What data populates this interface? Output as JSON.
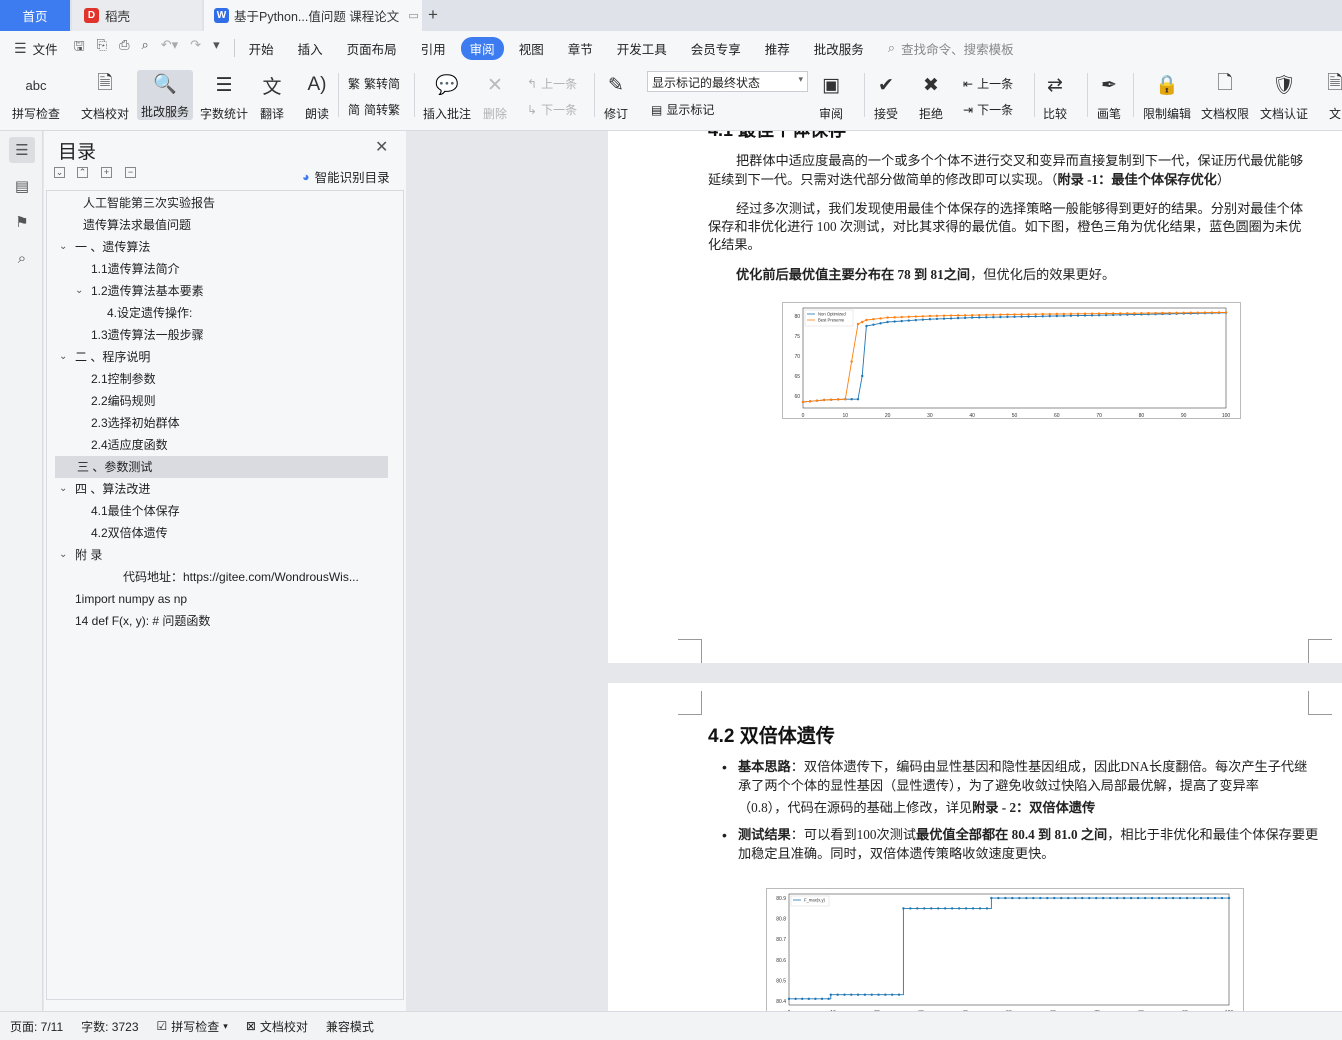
{
  "tabs": {
    "home": "首页",
    "docer": "稻壳",
    "doc": "基于Python...值问题 课程论文"
  },
  "menu": {
    "file": "文件",
    "items": [
      "开始",
      "插入",
      "页面布局",
      "引用",
      "审阅",
      "视图",
      "章节",
      "开发工具",
      "会员专享",
      "推荐",
      "批改服务"
    ],
    "active": "审阅",
    "search": "查找命令、搜索模板"
  },
  "ribbon": {
    "spell": "拼写检查",
    "proof": "文档校对",
    "review_service": "批改服务",
    "wordcount": "字数统计",
    "translate": "翻译",
    "read": "朗读",
    "trad": "繁转简",
    "simp": "简转繁",
    "insert_comment": "插入批注",
    "delete": "删除",
    "prev_comment": "上一条",
    "next_comment": "下一条",
    "revise": "修订",
    "mark_state": "显示标记的最终状态",
    "show_marks": "显示标记",
    "review": "审阅",
    "accept": "接受",
    "reject": "拒绝",
    "prev_change": "上一条",
    "next_change": "下一条",
    "compare": "比较",
    "pen": "画笔",
    "restrict": "限制编辑",
    "doc_rights": "文档权限",
    "doc_cert": "文档认证",
    "doc_more": "文"
  },
  "toc": {
    "title": "目录",
    "smart": "智能识别目录",
    "items": [
      {
        "text": "人工智能第三次实验报告",
        "indent": 1,
        "chev": ""
      },
      {
        "text": "遗传算法求最值问题",
        "indent": 1,
        "chev": ""
      },
      {
        "text": "一 、遗传算法",
        "indent": 0,
        "chev": "v"
      },
      {
        "text": "1.1遗传算法简介",
        "indent": 2,
        "chev": ""
      },
      {
        "text": "1.2遗传算法基本要素",
        "indent": 2,
        "chev": "v"
      },
      {
        "text": "4.设定遗传操作:",
        "indent": 3,
        "chev": ""
      },
      {
        "text": "1.3遗传算法一般步骤",
        "indent": 2,
        "chev": ""
      },
      {
        "text": "二 、程序说明",
        "indent": 0,
        "chev": "v"
      },
      {
        "text": "2.1控制参数",
        "indent": 2,
        "chev": ""
      },
      {
        "text": "2.2编码规则",
        "indent": 2,
        "chev": ""
      },
      {
        "text": "2.3选择初始群体",
        "indent": 2,
        "chev": ""
      },
      {
        "text": "2.4适应度函数",
        "indent": 2,
        "chev": ""
      },
      {
        "text": "三 、参数测试",
        "indent": 0,
        "chev": "",
        "selected": true
      },
      {
        "text": "四 、算法改进",
        "indent": 0,
        "chev": "v"
      },
      {
        "text": "4.1最佳个体保存",
        "indent": 2,
        "chev": ""
      },
      {
        "text": "4.2双倍体遗传",
        "indent": 2,
        "chev": ""
      },
      {
        "text": "附 录",
        "indent": 0,
        "chev": "v"
      },
      {
        "text": "代码地址：https://gitee.com/WondrousWis...",
        "indent": 4,
        "chev": ""
      },
      {
        "text": "1import numpy as np",
        "indent": 0,
        "chev": ""
      },
      {
        "text": "14 def F(x, y): # 问题函数",
        "indent": 0,
        "chev": ""
      }
    ]
  },
  "page1": {
    "heading_partial": "4.1 最佳个体保存",
    "p1a": "把群体中适应度最高的一个或多个个体不进行交叉和变异而直接复制到下一代，保证历代最优能够",
    "p1b": "延续到下一代。只需对迭代部分做简单的修改即可以实现。（",
    "p1b_bold": "附录 -1：最佳个体保存优化",
    "p1b_end": "）",
    "p2a": "经过多次测试，我们发现使用最佳个体保存的选择策略一般能够得到更好的结果。分别对最佳个体",
    "p2b": "保存和非优化进行 100 次测试，对比其求得的最优值。如下图，橙色三角为优化结果，蓝色圆圈为未优",
    "p2c": "化结果。",
    "p3_bold": "优化前后最优值主要分布在 78 到 81之间",
    "p3_end": "，但优化后的效果更好。"
  },
  "page2": {
    "heading": "4.2 双倍体遗传",
    "b1_label": "基本思路",
    "b1a": "：双倍体遗传下，编码由显性基因和隐性基因组成，因此DNA长度翻倍。每次产生子代继",
    "b1b": "承了两个个体的显性基因（显性遗传），为了避免收敛过快陷入局部最优解，提高了变异率",
    "b1c": "（0.8），代码在源码的基础上修改，详见",
    "b1c_bold": "附录 - 2：双倍体遗传",
    "b2_label": "测试结果",
    "b2a": "：可以看到100次测试",
    "b2a_bold": "最优值全部都在 80.4 到 81.0 之间",
    "b2a_end": "，相比于非优化和最佳个体保存要更",
    "b2b": "加稳定且准确。同时，双倍体遗传策略收敛速度更快。"
  },
  "chart_data": [
    {
      "type": "line",
      "x": [
        0,
        5,
        10,
        13,
        14,
        15,
        20,
        30,
        40,
        50,
        60,
        70,
        80,
        90,
        100
      ],
      "series": [
        {
          "name": "Non Optimized",
          "color": "#1f77b4",
          "values": [
            58.5,
            59,
            59.2,
            59.2,
            65,
            77.5,
            78.5,
            79.2,
            79.6,
            79.8,
            80,
            80.2,
            80.4,
            80.6,
            80.8
          ]
        },
        {
          "name": "Best Preserve",
          "color": "#ff7f0e",
          "values": [
            58.5,
            59,
            59.2,
            78,
            78.5,
            79,
            79.6,
            80,
            80.2,
            80.4,
            80.5,
            80.6,
            80.7,
            80.8,
            80.9
          ]
        }
      ],
      "xlim": [
        0,
        100
      ],
      "ylim": [
        57,
        82
      ],
      "xticks": [
        "0",
        "10",
        "20",
        "30",
        "40",
        "50",
        "60",
        "70",
        "80",
        "90",
        "100"
      ],
      "yticks": [
        "60",
        "65",
        "70",
        "75",
        "80"
      ]
    },
    {
      "type": "line",
      "x": [
        0,
        9,
        9.5,
        25,
        26,
        45,
        46,
        100
      ],
      "series": [
        {
          "name": "F_max(x,y)",
          "color": "#1f77b4",
          "values": [
            80.41,
            80.41,
            80.43,
            80.43,
            80.85,
            80.85,
            80.9,
            80.9
          ]
        }
      ],
      "xlim": [
        0,
        100
      ],
      "ylim": [
        80.38,
        80.92
      ],
      "xticks": [
        "0",
        "10",
        "20",
        "30",
        "40",
        "50",
        "60",
        "70",
        "80",
        "90",
        "100"
      ],
      "yticks": [
        "80.4",
        "80.5",
        "80.6",
        "80.7",
        "80.8",
        "80.9"
      ]
    }
  ],
  "status": {
    "page": "页面: 7/11",
    "words": "字数: 3723",
    "spell": "拼写检查",
    "proof": "文档校对",
    "compat": "兼容模式"
  }
}
